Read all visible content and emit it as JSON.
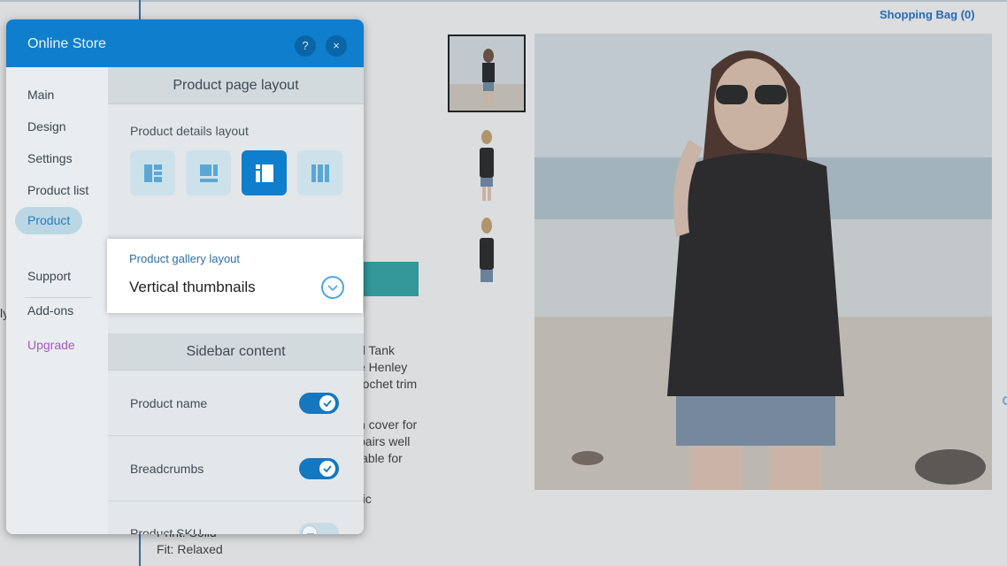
{
  "store": {
    "shopping_bag": "Shopping Bag (0)",
    "description_lines": [
      "d Tank",
      "e Henley",
      "rochet trim",
      "",
      "n cover for",
      "pairs well",
      "lable for",
      "",
      "ric"
    ],
    "spec_lines": [
      "Print: Solid",
      "Fit: Relaxed"
    ],
    "edge_fragment": "ly"
  },
  "panel": {
    "title": "Online Store",
    "help_label": "?",
    "close_label": "×",
    "nav": {
      "items": [
        {
          "label": "Main"
        },
        {
          "label": "Design"
        },
        {
          "label": "Settings"
        },
        {
          "label": "Product list"
        },
        {
          "label": "Product",
          "active": true
        }
      ],
      "secondary": [
        {
          "label": "Support"
        },
        {
          "label": "Add-ons"
        },
        {
          "label": "Upgrade"
        }
      ]
    },
    "product_page_layout": {
      "heading": "Product page layout",
      "details_layout_label": "Product details layout",
      "options": [
        "layout-left-details",
        "layout-bottom-details",
        "layout-side-details",
        "layout-columns"
      ],
      "selected_index": 2
    },
    "gallery_layout": {
      "label": "Product gallery layout",
      "value": "Vertical thumbnails"
    },
    "sidebar_content": {
      "heading": "Sidebar content",
      "toggles": [
        {
          "label": "Product name",
          "on": true
        },
        {
          "label": "Breadcrumbs",
          "on": true
        },
        {
          "label": "Product SKU",
          "on": false
        }
      ]
    }
  },
  "colors": {
    "accent": "#0f7ecc",
    "upgrade": "#a957bf",
    "link": "#1a6cc9"
  }
}
